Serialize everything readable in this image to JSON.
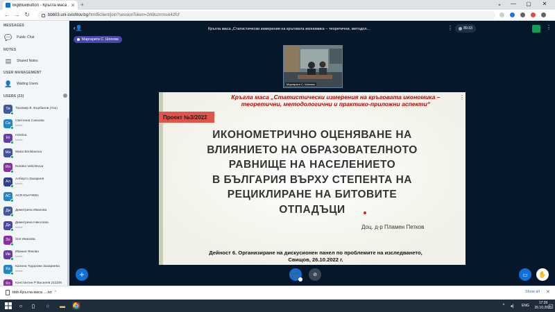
{
  "browser": {
    "tab_title": "BigBlueButton - Кръгла маса ...",
    "new_tab": "+",
    "url_host": "bbb03.uni-svishtov.bg",
    "url_path": "/html5client/join?sessionToken=2rk8szrrmsxi42fcf",
    "window_controls": [
      "⌄",
      "—",
      "▢",
      "✕"
    ]
  },
  "sidebar": {
    "messages_header": "MESSAGES",
    "public_chat": "Public Chat",
    "notes_header": "NOTES",
    "shared_notes": "Shared Notes",
    "user_mgmt_header": "USER MANAGEMENT",
    "waiting_users": "Waiting Users",
    "users_header": "USERS (23)",
    "users": [
      {
        "initials": "Ти",
        "name": "Тихомир В. Върбанов (You)",
        "sub": "",
        "color": "#3d5a9e"
      },
      {
        "initials": "Св",
        "name": "Светлана Саяхова",
        "sub": "Mobile",
        "color": "#1e88c8"
      },
      {
        "initials": "Hr",
        "name": "Hristina",
        "sub": "Mobile",
        "color": "#6a3da5"
      },
      {
        "initials": "Ma",
        "name": "Maria Borislavova",
        "sub": "",
        "color": "#3d4fa8"
      },
      {
        "initials": "Ro",
        "name": "Rositsa Velichkova",
        "sub": "",
        "color": "#8e2ea5"
      },
      {
        "initials": "Ал",
        "name": "Алберто Захариев",
        "sub": "Mobile",
        "color": "#2e3f8f"
      },
      {
        "initials": "АС",
        "name": "АСЯ КЪНЧЕВА",
        "sub": "",
        "color": "#1e88c8"
      },
      {
        "initials": "Ди",
        "name": "Димитрина Иванова",
        "sub": "",
        "color": "#3d5a9e"
      },
      {
        "initials": "Ди",
        "name": "Димитрина Николова",
        "sub": "Mobile",
        "color": "#4a48a6"
      },
      {
        "initials": "Зо",
        "name": "Зоя Иванова",
        "sub": "",
        "color": "#8e2ea5"
      },
      {
        "initials": "Ив",
        "name": "Ивания Янкова",
        "sub": "Mobile",
        "color": "#6a3da5"
      },
      {
        "initials": "Ка",
        "name": "Калина Тодорова Захариева",
        "sub": "Mobile",
        "color": "#1e88c8"
      },
      {
        "initials": "Ко",
        "name": "Константин Р Василев 211106",
        "sub": "",
        "color": "#8e2ea5"
      }
    ]
  },
  "main": {
    "meeting_title": "Кръгла маса „Статистически измерения на кръговата икономика – теоретични, методол...",
    "recording_time": "89:33",
    "presenter_name": "Маргарита С. Шопова",
    "webcam_label": "Маргарита С. Шопова"
  },
  "slide": {
    "header": "Кръгла маса „Статистически измерения на кръговата икономика – теоретични, методологични и практико-приложни аспекти“",
    "badge": "Проект №3/2022",
    "title_lines": [
      "ИКОНОМЕТРИЧНО ОЦЕНЯВАНЕ НА",
      "ВЛИЯНИЕТО НА ОБРАЗОВАТЕЛНОТО",
      "РАВНИЩЕ НА НАСЕЛЕНИЕТО",
      "В БЪЛГАРИЯ ВЪРХУ СТЕПЕНТА НА",
      "РЕЦИКЛИРАНЕ НА БИТОВИТЕ",
      "ОТПАДЪЦИ"
    ],
    "author": "Доц. д-р Пламен Петков",
    "footer_line1": "Дейност 6. Организиране на дискусионен панел по проблемите на изследването,",
    "footer_line2": "Свищов, 26.10.2022 г."
  },
  "downloads": {
    "file_name": "bbb-Кръгла маса ....txt",
    "show_all": "Show all"
  },
  "taskbar": {
    "lang": "ENG",
    "time": "17:39",
    "date": "26.10.2022"
  },
  "colors": {
    "bbb_dark": "#06172a",
    "accent_blue": "#0f70d7",
    "slide_header_red": "#c00000",
    "badge_red": "#e0554a"
  }
}
